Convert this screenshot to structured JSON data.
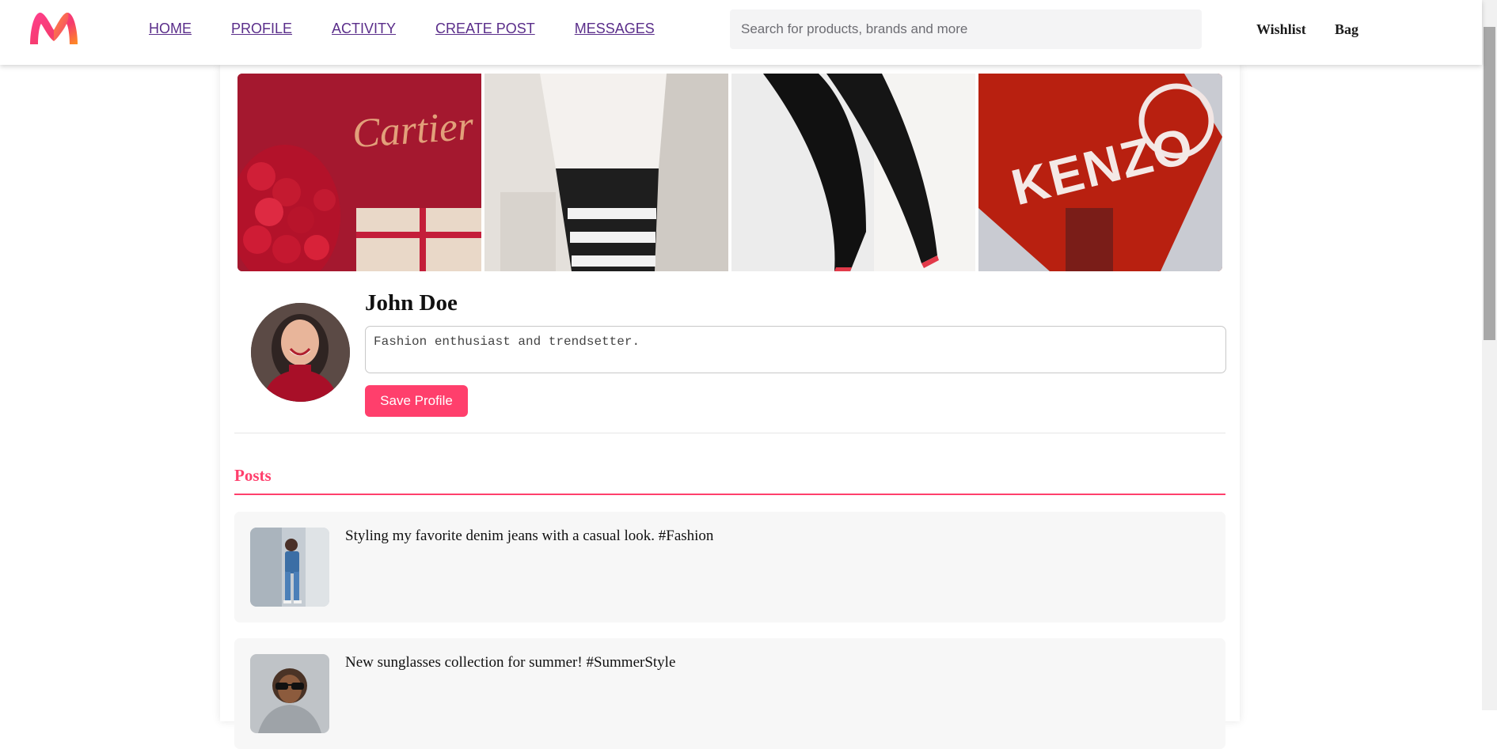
{
  "header": {
    "nav": [
      "HOME",
      "PROFILE",
      "ACTIVITY",
      "CREATE POST",
      "MESSAGES"
    ],
    "search_placeholder": "Search for products, brands and more",
    "wishlist_label": "Wishlist",
    "bag_label": "Bag"
  },
  "banner": {
    "tile1_text": "Cartier",
    "tile4_text": "KENZO"
  },
  "profile": {
    "name": "John Doe",
    "bio": "Fashion enthusiast and trendsetter.",
    "save_label": "Save Profile"
  },
  "posts": {
    "title": "Posts",
    "items": [
      {
        "text": "Styling my favorite denim jeans with a casual look. #Fashion"
      },
      {
        "text": "New sunglasses collection for summer! #SummerStyle"
      }
    ]
  },
  "colors": {
    "accent": "#ff3f6c",
    "nav_link": "#5a2d8a"
  }
}
